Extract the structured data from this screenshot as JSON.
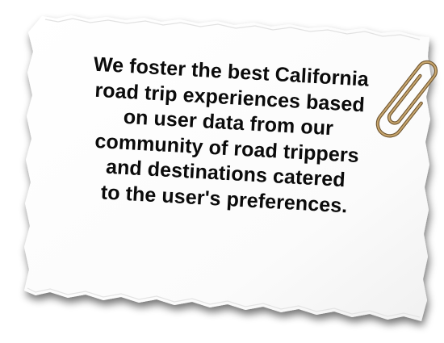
{
  "note": {
    "lines": [
      "We foster the best California",
      "road trip experiences based",
      "on user data from our",
      "community of road trippers",
      "and destinations catered",
      "to the user's preferences."
    ]
  },
  "icons": {
    "paperclip": "paperclip-icon",
    "paper": "torn-paper-note"
  },
  "colors": {
    "paper": "#ffffff",
    "paper_shadow": "#9a9a9a",
    "text": "#0b0b0b",
    "clip": "#9c7b4a"
  }
}
